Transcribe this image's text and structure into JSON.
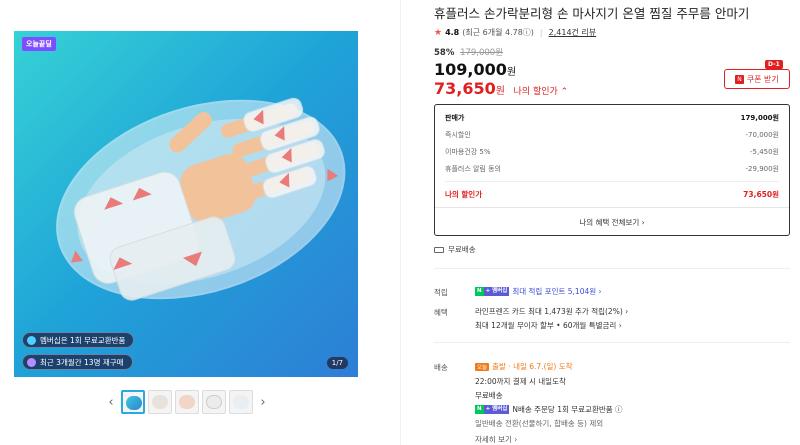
{
  "gallery": {
    "badge": "오늘끝딜",
    "pill1": "멤버십은 1회 무료교환반품",
    "pill2": "최근 3개월간 13명 재구매",
    "counter": "1/7",
    "prev": "‹",
    "next": "›",
    "thumb_count": 5
  },
  "product": {
    "title": "휴플러스 손가락분리형 손 마사지기 온열 찜질 주무름 안마기",
    "star": "★",
    "rating": "4.8",
    "rating_recent": "(최근 6개월 4.78ⓘ)",
    "reviews": "2,414건 리뷰",
    "discount_pct": "58%",
    "original_price": "179,000원",
    "price": "109,000",
    "price_unit": "원",
    "my_price": "73,650",
    "my_price_unit": "원",
    "my_price_label": "나의 할인가 ⌃",
    "coupon_icon": "N",
    "coupon_label": "쿠폰 받기",
    "dday": "D-1"
  },
  "breakdown": {
    "rows": [
      {
        "label": "판매가",
        "value": "179,000원"
      },
      {
        "label": "즉시할인",
        "value": "-70,000원"
      },
      {
        "label": "이마용건강 5%",
        "value": "-5,450원"
      },
      {
        "label": "휴플러스 알림 동의",
        "value": "-29,900원"
      }
    ],
    "my_label": "나의 할인가",
    "my_value": "73,650원",
    "see_all": "나의 혜택 전체보기 ›"
  },
  "shipping_free": "무료배송",
  "points": {
    "label": "적립",
    "n": "N",
    "plus": "+ 멤버십",
    "text": "최대 적립 포인트 5,104원 ›"
  },
  "benefit": {
    "label": "혜택",
    "line1": "라인프렌즈 카드 최대 1,473원 추가 적립(2%) ›",
    "line2": "최대 12개월 무이자 할부 • 60개월 특별금리 ›"
  },
  "delivery": {
    "label": "배송",
    "today": "오늘",
    "line1": "출발 · 내일 6.7.(일) 도착",
    "line2": "22:00까지 결제 시 내일도착",
    "line3": "무료배송",
    "n": "N",
    "plus": "+ 멤버십",
    "line4": "N배송 주문당 1회 무료교환반품 ⓘ",
    "line5": "일반배송 전환(선물하기, 합배송 등) 제외",
    "more": "자세히 보기 ›"
  }
}
